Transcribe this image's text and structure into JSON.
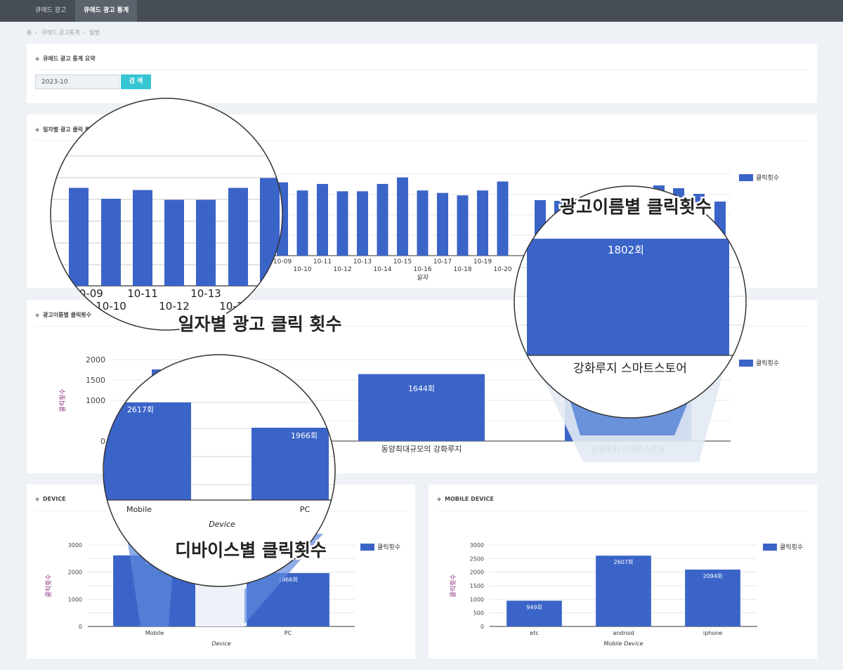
{
  "nav": {
    "tabs": [
      "큐애드 광고",
      "큐애드 광고 통계"
    ]
  },
  "breadcrumb": [
    "홈",
    "큐애드 광고통계",
    "월별"
  ],
  "summary": {
    "title": "큐애드 광고 통계 요약",
    "date_value": "2023-10",
    "search_label": "검  색"
  },
  "colors": {
    "bar": "#3b64c8",
    "accent_button": "#36c6d3",
    "axis_title": "#8b2f7c"
  },
  "chart_data": [
    {
      "id": "daily",
      "type": "bar",
      "title": "일자별 광고 클릭 횟수",
      "xlabel": "일자",
      "legend": "클릭횟수",
      "legend_position": "right",
      "categories": [
        "10-09",
        "10-10",
        "10-11",
        "10-12",
        "10-13",
        "10-14",
        "10-15",
        "10-16",
        "10-17",
        "10-18",
        "10-19",
        "10-20"
      ],
      "values": [
        90,
        80,
        88,
        79,
        79,
        88,
        96,
        80,
        77,
        74,
        80,
        91
      ],
      "grid": true
    },
    {
      "id": "by_ad_name",
      "type": "bar",
      "title": "광고이름별 클릭횟수",
      "ylabel": "클릭횟수",
      "legend": "클릭횟수",
      "legend_position": "right",
      "categories": [
        "동양최대규모의 강화루지",
        "강화루지 스마트스토어"
      ],
      "values": [
        1644,
        1802
      ],
      "value_labels": [
        "1644회",
        "1802회"
      ],
      "yticks": [
        0,
        1000,
        1500,
        2000
      ],
      "ylim": [
        0,
        2000
      ],
      "grid": true
    },
    {
      "id": "device",
      "type": "bar",
      "title": "DEVICE",
      "xlabel": "Device",
      "ylabel": "클릭횟수",
      "legend": "클릭횟수",
      "legend_position": "right",
      "categories": [
        "Mobile",
        "PC"
      ],
      "values": [
        2617,
        1966
      ],
      "value_labels": [
        "2617회",
        "1966회"
      ],
      "yticks": [
        0,
        1000,
        2000,
        3000
      ],
      "ylim": [
        0,
        3000
      ],
      "grid": true
    },
    {
      "id": "mobile_device",
      "type": "bar",
      "title": "MOBILE DEVICE",
      "xlabel": "Mobile Device",
      "ylabel": "클릭횟수",
      "legend": "클릭횟수",
      "legend_position": "right",
      "categories": [
        "etc",
        "android",
        "iphone"
      ],
      "values": [
        949,
        2607,
        2094
      ],
      "value_labels": [
        "949회",
        "2607회",
        "2094회"
      ],
      "yticks": [
        0,
        500,
        1000,
        1500,
        2000,
        2500,
        3000
      ],
      "ylim": [
        0,
        3000
      ],
      "grid": true
    }
  ],
  "zoom_labels": {
    "daily": "일자별 광고 클릭 횟수",
    "by_ad_name": "광고이름별 클릭횟수",
    "device": "디바이스별 클릭횟수"
  }
}
